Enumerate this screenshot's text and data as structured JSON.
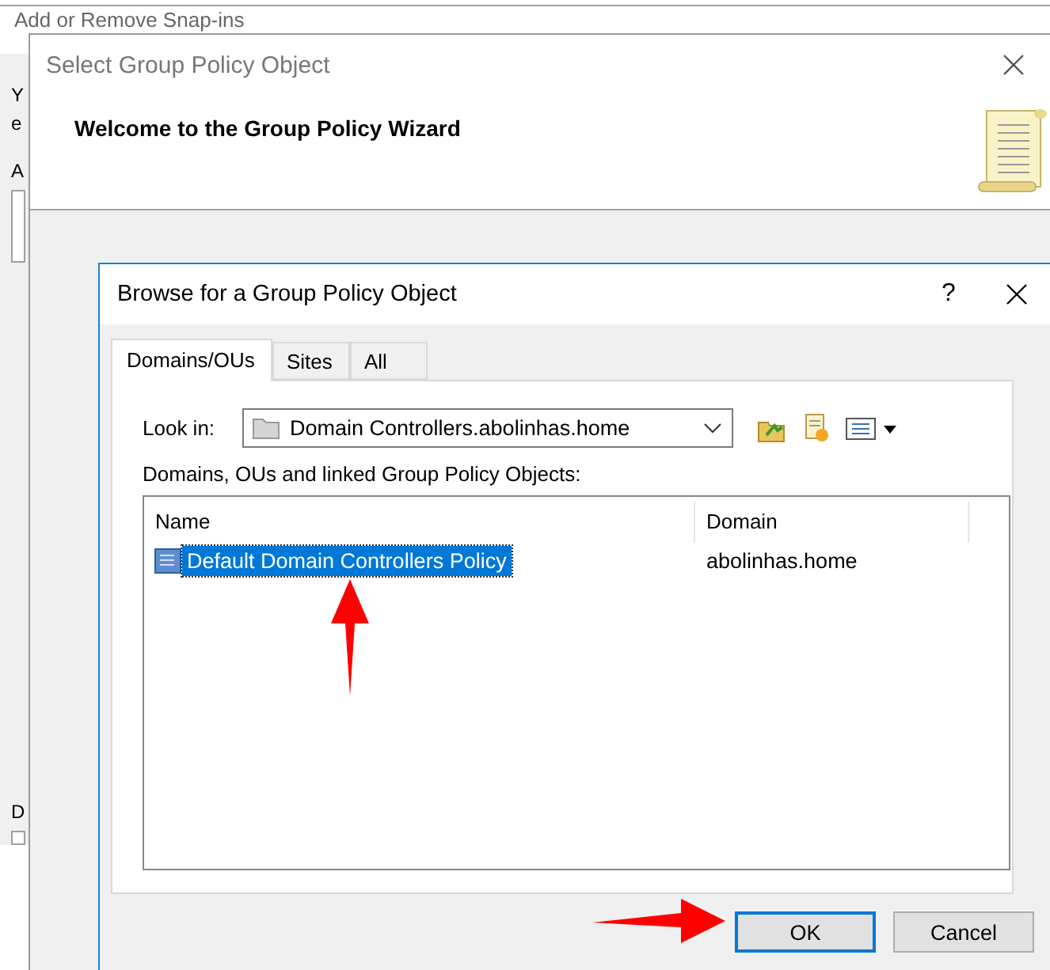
{
  "background_window": {
    "title": "Add or Remove Snap-ins",
    "fragments": [
      "Y",
      "e",
      "A",
      "D"
    ]
  },
  "wizard_window": {
    "title": "Select Group Policy Object",
    "heading": "Welcome to the Group Policy Wizard"
  },
  "browse_dialog": {
    "title": "Browse for a Group Policy Object",
    "help": "?",
    "tabs": [
      {
        "label": "Domains/OUs",
        "selected": true
      },
      {
        "label": "Sites",
        "selected": false
      },
      {
        "label": "All",
        "selected": false
      }
    ],
    "look_in": {
      "label": "Look in:",
      "value": "Domain Controllers.abolinhas.home"
    },
    "list_label": "Domains, OUs and linked Group Policy Objects:",
    "columns": [
      "Name",
      "Domain"
    ],
    "rows": [
      {
        "name": "Default Domain Controllers Policy",
        "domain": "abolinhas.home",
        "selected": true
      }
    ],
    "buttons": [
      {
        "label": "OK",
        "default": true
      },
      {
        "label": "Cancel",
        "default": false
      }
    ]
  }
}
